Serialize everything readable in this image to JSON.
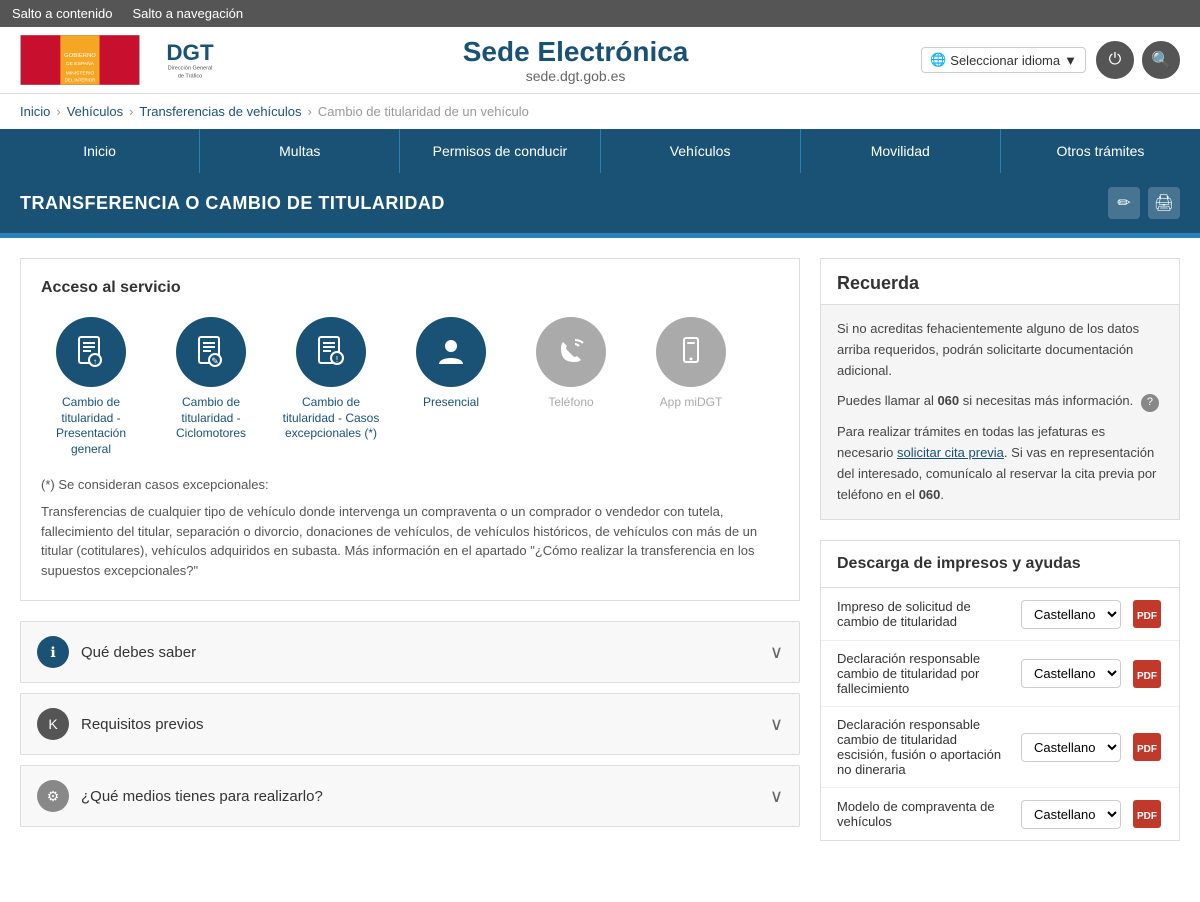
{
  "skip_links": {
    "content": "Salto a contenido",
    "navigation": "Salto a navegación"
  },
  "header": {
    "logo_gobierno_alt": "Gobierno de España - Ministerio del Interior",
    "logo_dgt_alt": "DGT - Dirección General de Tráfico",
    "sede_title": "Sede Electrónica",
    "sede_url": "sede.dgt.gob.es",
    "lang_button": "Seleccionar idioma",
    "icon_user": "⏻",
    "icon_search": "🔍"
  },
  "breadcrumb": {
    "items": [
      "Inicio",
      "Vehículos",
      "Transferencias de vehículos",
      "Cambio de titularidad de un vehículo"
    ]
  },
  "nav": {
    "items": [
      "Inicio",
      "Multas",
      "Permisos de conducir",
      "Vehículos",
      "Movilidad",
      "Otros trámites"
    ]
  },
  "page": {
    "title": "TRANSFERENCIA O CAMBIO DE TITULARIDAD",
    "edit_icon": "✏",
    "print_icon": "🖨"
  },
  "service_access": {
    "title": "Acceso al servicio",
    "icons": [
      {
        "id": "cambio-presentacion",
        "label": "Cambio de titularidad - Presentación general",
        "color": "blue",
        "icon": "doc"
      },
      {
        "id": "cambio-ciclomotores",
        "label": "Cambio de titularidad - Ciclomotores",
        "color": "blue",
        "icon": "doc2"
      },
      {
        "id": "cambio-excepcionales",
        "label": "Cambio de titularidad - Casos excepcionales (*)",
        "color": "blue",
        "icon": "doc3"
      },
      {
        "id": "presencial",
        "label": "Presencial",
        "color": "blue",
        "icon": "person"
      },
      {
        "id": "telefono",
        "label": "Teléfono",
        "color": "grey",
        "icon": "phone"
      },
      {
        "id": "app-midgt",
        "label": "App miDGT",
        "color": "grey",
        "icon": "mobile"
      }
    ]
  },
  "notes": {
    "excepcionales_title": "(*) Se consideran casos excepcionales:",
    "excepcionales_text": "Transferencias de cualquier tipo de vehículo donde intervenga un compraventa o un comprador o vendedor con tutela, fallecimiento del titular, separación o divorcio, donaciones de vehículos, de vehículos históricos, de vehículos con más de un titular (cotitulares), vehículos adquiridos en subasta. Más información en el apartado \"¿Cómo realizar la transferencia en los supuestos excepcionales?\""
  },
  "accordions": [
    {
      "id": "que-debes-saber",
      "icon": "ℹ",
      "icon_color": "blue",
      "title": "Qué debes saber"
    },
    {
      "id": "requisitos-previos",
      "icon": "K",
      "icon_color": "dark",
      "title": "Requisitos previos"
    },
    {
      "id": "medios",
      "icon": "⚙",
      "icon_color": "grey",
      "title": "¿Qué medios tienes para realizarlo?"
    }
  ],
  "recuerda": {
    "title": "Recuerda",
    "paragraphs": [
      "Si no acreditas fehacientemente alguno de los datos arriba requeridos, podrán solicitarte documentación adicional.",
      "Puedes llamar al 060 si necesitas más información.",
      "Para realizar trámites en todas las jefaturas es necesario solicitar cita previa. Si vas en representación del interesado, comunícalo al reservar la cita previa por teléfono en el 060."
    ],
    "link_text": "solicitar cita previa",
    "num_060": "060"
  },
  "descarga": {
    "title": "Descarga de impresos y ayudas",
    "items": [
      {
        "id": "impreso-solicitud",
        "label": "Impreso de solicitud de cambio de titularidad",
        "lang": "Castellano"
      },
      {
        "id": "declaracion-fallecimiento",
        "label": "Declaración responsable cambio de titularidad por fallecimiento",
        "lang": "Castellano"
      },
      {
        "id": "declaracion-escision",
        "label": "Declaración responsable cambio de titularidad escisión, fusión o aportación no dineraria",
        "lang": "Castellano"
      },
      {
        "id": "modelo-compraventa",
        "label": "Modelo de compraventa de vehículos",
        "lang": "Castellano"
      }
    ]
  }
}
